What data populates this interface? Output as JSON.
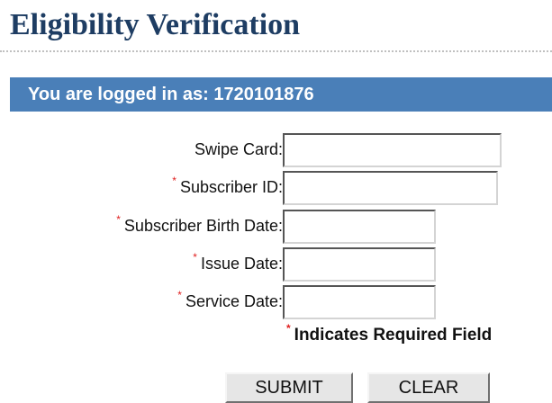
{
  "page": {
    "title": "Eligibility Verification",
    "logged_in_prefix": "You are logged in as:",
    "logged_in_user": "1720101876"
  },
  "form": {
    "fields": [
      {
        "label": "Swipe Card:",
        "required": false,
        "value": ""
      },
      {
        "label": "Subscriber ID:",
        "required": true,
        "value": ""
      },
      {
        "label": "Subscriber Birth Date:",
        "required": true,
        "value": ""
      },
      {
        "label": "Issue Date:",
        "required": true,
        "value": ""
      },
      {
        "label": "Service Date:",
        "required": true,
        "value": ""
      }
    ],
    "required_marker": "*",
    "required_note": "Indicates Required Field",
    "submit_label": "SUBMIT",
    "clear_label": "CLEAR"
  },
  "colors": {
    "title": "#1e3d63",
    "login_bar": "#4a7fb8",
    "required_star": "#e02020"
  }
}
